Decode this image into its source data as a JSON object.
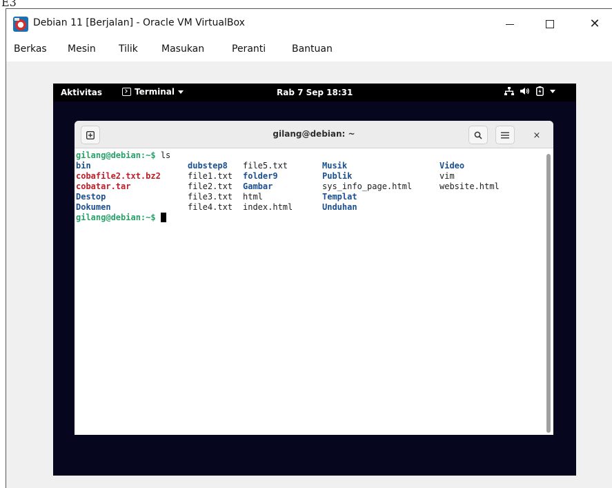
{
  "crop_glyph": "E3",
  "window": {
    "title": "Debian 11 [Berjalan] - Oracle VM VirtualBox",
    "close_glyph": "✕"
  },
  "menubar": {
    "items": [
      {
        "label": "Berkas"
      },
      {
        "label": "Mesin"
      },
      {
        "label": "Tilik"
      },
      {
        "label": "Masukan"
      },
      {
        "label": "Peranti"
      },
      {
        "label": "Bantuan"
      }
    ]
  },
  "gnome": {
    "activities": "Aktivitas",
    "app_menu": "Terminal",
    "clock": "Rab 7 Sep 18:31"
  },
  "terminal": {
    "title": "gilang@debian: ~",
    "close_glyph": "×",
    "prompt": "gilang@debian:~$",
    "command": " ls",
    "ls_rows": [
      [
        "bin",
        "dubstep8",
        "file5.txt",
        "Musik",
        "Video"
      ],
      [
        "cobafile2.txt.bz2",
        "file1.txt",
        "folder9",
        "Publik",
        "vim"
      ],
      [
        "cobatar.tar",
        "file2.txt",
        "Gambar",
        "sys_info_page.html",
        "website.html"
      ],
      [
        "Destop",
        "file3.txt",
        "html",
        "Templat",
        ""
      ],
      [
        "Dokumen",
        "file4.txt",
        "index.html",
        "Unduhan",
        ""
      ]
    ],
    "ls_styles": [
      [
        "dir",
        "dir",
        "file",
        "dir",
        "dir"
      ],
      [
        "arch",
        "file",
        "dir",
        "dir",
        "file"
      ],
      [
        "arch",
        "file",
        "dir",
        "file",
        "file"
      ],
      [
        "dir",
        "file",
        "file",
        "dir",
        "file"
      ],
      [
        "dir",
        "file",
        "file",
        "dir",
        "file"
      ]
    ]
  },
  "colors": {
    "vm_background": "#06071f",
    "prompt_green": "#26a269",
    "directory_blue": "#1a4f8f",
    "archive_red": "#c01c28"
  },
  "icons": {
    "app": "virtualbox-icon",
    "new_tab": "new-tab-icon",
    "search": "search-icon",
    "hamburger": "hamburger-menu-icon",
    "network": "network-icon",
    "volume": "volume-icon",
    "battery": "battery-icon"
  }
}
